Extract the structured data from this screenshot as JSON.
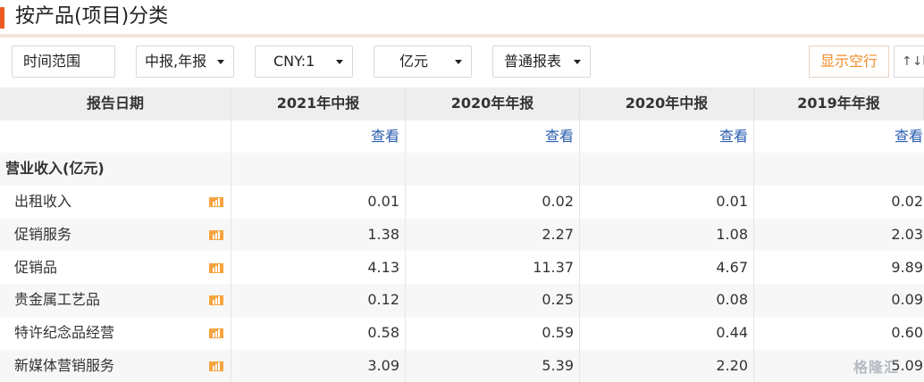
{
  "page": {
    "title": "按产品(项目)分类"
  },
  "toolbar": {
    "time_range": "时间范围",
    "period": "中报,年报",
    "currency": "CNY:1",
    "unit": "亿元",
    "report_type": "普通报表",
    "show_empty": "显示空行",
    "sort_label": "↑↓时"
  },
  "table": {
    "date_header": "报告日期",
    "columns": [
      "2021年中报",
      "2020年年报",
      "2020年中报",
      "2019年年报"
    ],
    "view_label": "查看",
    "section_label": "营业收入(亿元)",
    "rows": [
      {
        "label": "出租收入",
        "values": [
          "0.01",
          "0.02",
          "0.01",
          "0.02"
        ]
      },
      {
        "label": "促销服务",
        "values": [
          "1.38",
          "2.27",
          "1.08",
          "2.03"
        ]
      },
      {
        "label": "促销品",
        "values": [
          "4.13",
          "11.37",
          "4.67",
          "9.89"
        ]
      },
      {
        "label": "贵金属工艺品",
        "values": [
          "0.12",
          "0.25",
          "0.08",
          "0.09"
        ]
      },
      {
        "label": "特许纪念品经营",
        "values": [
          "0.58",
          "0.59",
          "0.44",
          "0.60"
        ]
      },
      {
        "label": "新媒体营销服务",
        "values": [
          "3.09",
          "5.39",
          "2.20",
          "5.09"
        ]
      }
    ]
  },
  "watermark": "格隆汇",
  "colors": {
    "accent": "#ee5a24",
    "link": "#2a5db0",
    "orange_text": "#f28c2a"
  },
  "icons": {
    "row_chart": "bar-chart-icon",
    "caret": "caret-down-icon"
  }
}
